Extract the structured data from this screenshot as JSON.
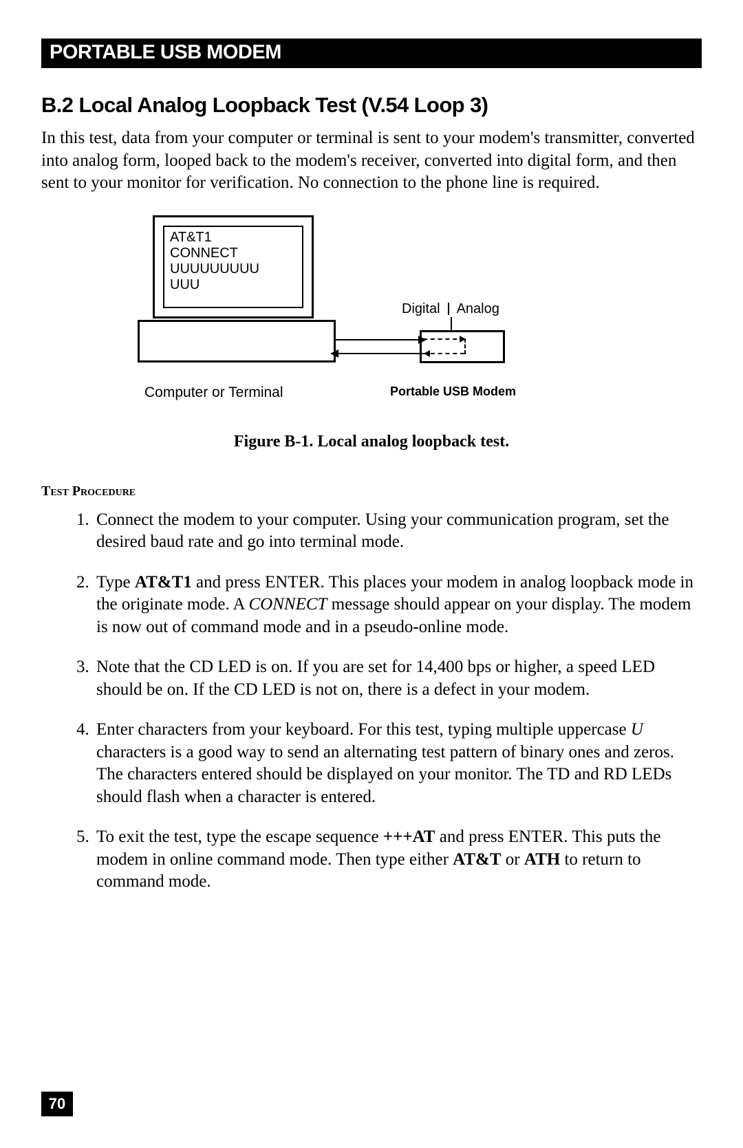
{
  "header": "PORTABLE USB MODEM",
  "section_title": "B.2 Local Analog Loopback Test (V.54 Loop 3)",
  "intro": "In this test, data from your computer or terminal is sent to your modem's transmitter, converted into analog form, looped back to the modem's receiver, converted into digital form, and then sent to your monitor for verification. No connection to the phone line is required.",
  "figure": {
    "monitor_text": "AT&T1\nCONNECT\nUUUUUUUUU\nUUU",
    "digital_label": "Digital",
    "analog_label": "Analog",
    "left_caption": "Computer or Terminal",
    "right_caption": "Portable USB Modem",
    "caption": "Figure B-1. Local analog loopback test."
  },
  "proc_heading": "Test Procedure",
  "steps": {
    "s1": "Connect the modem to your computer. Using your communication program, set the desired baud rate and go into terminal mode.",
    "s2_a": "Type ",
    "s2_cmd": "AT&T1",
    "s2_b": " and press ENTER. This places your modem in analog loopback mode in the originate mode. A ",
    "s2_msg": "CONNECT",
    "s2_c": " message should appear on your display. The modem is now out of command mode and in a pseudo-online mode.",
    "s3": "Note that the CD LED is on. If you are set for 14,400 bps or higher, a speed LED should be on. If the CD LED is not on, there is a defect in your modem.",
    "s4_a": "Enter characters from your keyboard. For this test, typing multiple uppercase ",
    "s4_u": "U",
    "s4_b": " characters is a good way to send an alternating test pattern of binary ones and zeros. The characters entered should be displayed on your monitor. The TD and RD LEDs should flash when a character is entered.",
    "s5_a": "To exit the test, type the escape sequence ",
    "s5_cmd1": "+++AT",
    "s5_b": " and press ENTER. This puts the modem in online command mode. Then type either ",
    "s5_cmd2": "AT&T",
    "s5_c": " or ",
    "s5_cmd3": "ATH",
    "s5_d": " to return to command mode."
  },
  "page_number": "70"
}
